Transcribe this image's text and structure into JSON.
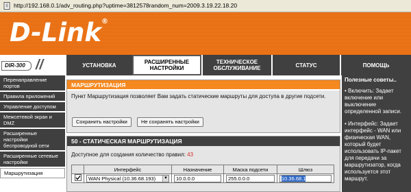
{
  "address_bar": {
    "url": "http://192.168.0.1/adv_routing.php?uptime=3812578random_num=2009.3.19.22.18.20"
  },
  "header": {
    "logo": "D-Link"
  },
  "nav": {
    "model": "DIR-300",
    "tabs": [
      {
        "label": "УСТАНОВКА"
      },
      {
        "label": "РАСШИРЕННЫЕ НАСТРОЙКИ"
      },
      {
        "label": "ТЕХНИЧЕСКОЕ ОБСЛУЖИВАНИЕ"
      },
      {
        "label": "СТАТУС"
      },
      {
        "label": "ПОМОЩЬ"
      }
    ]
  },
  "sidebar": {
    "items": [
      {
        "label": "Перенаправление портов"
      },
      {
        "label": "Правила приложений"
      },
      {
        "label": "Управление доступом"
      },
      {
        "label": "Межсетевой экран и DMZ"
      },
      {
        "label": "Расширенные настройки беспроводной сети"
      },
      {
        "label": "Расширенные сетевые настройки"
      },
      {
        "label": "Маршрутизация"
      }
    ]
  },
  "routing_panel": {
    "title": "МАРШРУТИЗАЦИЯ",
    "description": "Пункт Маршрутизация позволяет Вам задать статические маршруты для доступа в другие подсети.",
    "save_label": "Сохранить настройки",
    "dont_save_label": "Не сохранять настройки"
  },
  "static_routes": {
    "title": "50 - СТАТИЧЕСКАЯ МАРШРУТИЗАЦИЯ",
    "remaining_label": "Доступное для создания количество правил:",
    "remaining_count": "43",
    "columns": [
      "Интерфейс",
      "Назначение",
      "Маска подсети",
      "Шлюз"
    ],
    "row": {
      "checked": true,
      "interface": "WAN Physical (10.36.68.193)",
      "destination": "10.0.0.0",
      "mask": "255.0.0.0",
      "gateway": "10.36.68.1"
    }
  },
  "tips": {
    "title": "Полезные советы..",
    "items": [
      "• Включить: Задает включение или выключение определенной записи.",
      "• Интерфейс: Задает интерфейс - WAN или физическая WAN, который будет использовать IP-пакет для передачи за маршрутизатор, когда используется этот маршрут."
    ]
  },
  "colors": {
    "accent_orange": "#f5881f",
    "dark_gray": "#404040",
    "alert_red": "#d4302c"
  }
}
